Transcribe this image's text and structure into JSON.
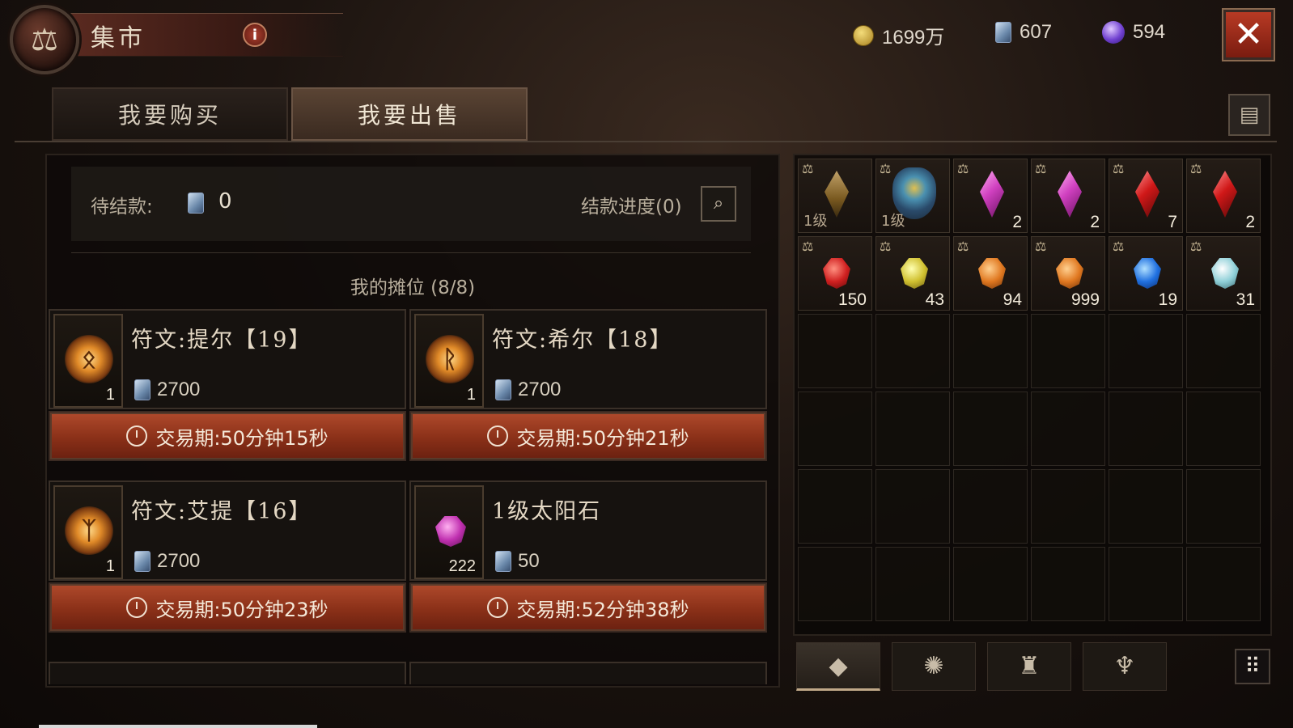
{
  "header": {
    "title": "集市",
    "info_label": "i",
    "close_label": "✕"
  },
  "currency": {
    "gold": "1699万",
    "scroll": "607",
    "orb": "594"
  },
  "tabs": {
    "buy": "我要购买",
    "sell": "我要出售"
  },
  "settlement": {
    "label": "待结款:",
    "value": "0",
    "progress_label": "结款进度(0)"
  },
  "stall": {
    "title": "我的摊位 (8/8)",
    "listings": [
      {
        "name": "符文:提尔【19】",
        "qty": "1",
        "price": "2700",
        "time": "交易期:50分钟15秒",
        "icon": "rune-tir-icon"
      },
      {
        "name": "符文:希尔【18】",
        "qty": "1",
        "price": "2700",
        "time": "交易期:50分钟21秒",
        "icon": "rune-shael-icon"
      },
      {
        "name": "符文:艾提【16】",
        "qty": "1",
        "price": "2700",
        "time": "交易期:50分钟23秒",
        "icon": "rune-eth-icon"
      },
      {
        "name": "1级太阳石",
        "qty": "222",
        "price": "50",
        "time": "交易期:52分钟38秒",
        "icon": "sunstone-icon"
      }
    ]
  },
  "inventory": {
    "row1": [
      {
        "icon": "amber-crystal-icon",
        "level": "1级",
        "qty": ""
      },
      {
        "icon": "shield-charm-icon",
        "level": "1级",
        "qty": ""
      },
      {
        "icon": "magenta-gem-icon",
        "level": "",
        "qty": "2"
      },
      {
        "icon": "magenta-gem-icon",
        "level": "",
        "qty": "2"
      },
      {
        "icon": "red-gem-icon",
        "level": "",
        "qty": "7"
      },
      {
        "icon": "red-gem-icon",
        "level": "",
        "qty": "2"
      }
    ],
    "row2": [
      {
        "icon": "ruby-icon",
        "qty": "150"
      },
      {
        "icon": "topaz-icon",
        "qty": "43"
      },
      {
        "icon": "amber-icon",
        "qty": "94"
      },
      {
        "icon": "amber-icon",
        "qty": "999"
      },
      {
        "icon": "sapphire-icon",
        "qty": "19"
      },
      {
        "icon": "diamond-icon",
        "qty": "31"
      }
    ]
  },
  "bottom_tabs": [
    "gem-tab-icon",
    "rune-tab-icon",
    "bag-tab-icon",
    "demon-tab-icon"
  ],
  "colors": {
    "accent_red": "#8a3018",
    "panel": "#16120f",
    "text": "#e4d8c4"
  }
}
